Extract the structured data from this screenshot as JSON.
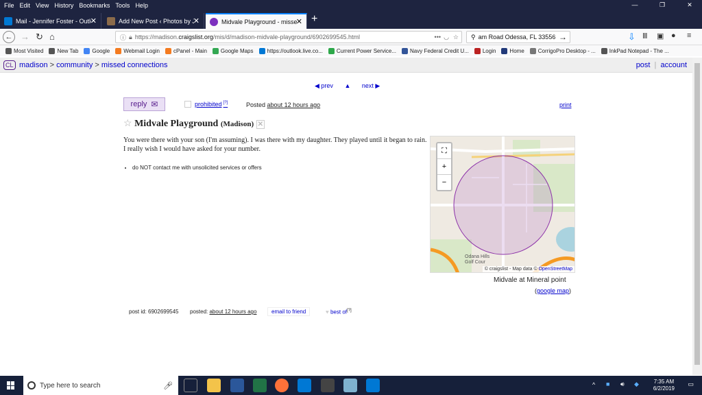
{
  "menu": [
    "File",
    "Edit",
    "View",
    "History",
    "Bookmarks",
    "Tools",
    "Help"
  ],
  "window_controls": [
    "—",
    "❐",
    "✕"
  ],
  "tabs": [
    {
      "title": "Mail - Jennifer Foster - Outlook",
      "color": "#0078d4"
    },
    {
      "title": "Add New Post ‹ Photos by JFos",
      "color": "#8b6b4a"
    },
    {
      "title": "Midvale Playground - missed c",
      "color": "#7b2fbe"
    }
  ],
  "url": {
    "prefix": "https://madison.",
    "domain": "craigslist.org",
    "path": "/mis/d/madison-midvale-playground/6902699545.html"
  },
  "search_value": "am Road Odessa, FL 33556",
  "bookmarks": [
    {
      "label": "Most Visited",
      "color": "#555"
    },
    {
      "label": "New Tab",
      "color": "#555"
    },
    {
      "label": "Google",
      "color": "#4285f4"
    },
    {
      "label": "Webmail Login",
      "color": "#f47b20"
    },
    {
      "label": "cPanel - Main",
      "color": "#f47b20"
    },
    {
      "label": "Google Maps",
      "color": "#34a853"
    },
    {
      "label": "https://outlook.live.co...",
      "color": "#0078d4"
    },
    {
      "label": "Current Power Service...",
      "color": "#2ea84a"
    },
    {
      "label": "Navy Federal Credit U...",
      "color": "#335599"
    },
    {
      "label": "Login",
      "color": "#b22"
    },
    {
      "label": "Home",
      "color": "#223a7a"
    },
    {
      "label": "CorrigoPro Desktop - ...",
      "color": "#777"
    },
    {
      "label": "InkPad Notepad - The ...",
      "color": "#555"
    }
  ],
  "cl": {
    "logo": "CL",
    "crumbs": [
      "madison",
      "community",
      "missed connections"
    ],
    "sep": ">",
    "post": "post",
    "account": "account"
  },
  "pager": {
    "prev": "◀ prev",
    "up": "▲",
    "next": "next ▶"
  },
  "reply": "reply",
  "prohibited": "prohibited",
  "prohibited_sup": "[?]",
  "posted_label": "Posted",
  "posted_time": "about 12 hours ago",
  "print": "print",
  "title": "Midvale Playground",
  "title_loc": "(Madison)",
  "body": "You were there with your son (I'm assuming). I was there with my daughter. They played until it began to rain. I really wish I would have asked for your number.",
  "notice": "do NOT contact me with unsolicited services or offers",
  "map": {
    "expand": "⛶",
    "plus": "+",
    "minus": "−",
    "label_odana": "Odana Hills Golf Cour",
    "attrib_prefix": "© craigslist - Map data ©",
    "attrib_link": "OpenStreetMap",
    "location": "Midvale at Mineral point",
    "google": "google map"
  },
  "footer": {
    "post_id": "post id: 6902699545",
    "posted_label": "posted:",
    "posted_time": "about 12 hours ago",
    "email": "email to friend",
    "best": "best of",
    "best_sup": "[?]"
  },
  "taskbar": {
    "search_placeholder": "Type here to search",
    "time": "7:35 AM",
    "date": "6/2/2019"
  },
  "colors": {
    "cl_purple": "#551a8b",
    "link_blue": "#0000cc",
    "taskbar": "#16203a",
    "chrome_dark": "#1e2440"
  }
}
